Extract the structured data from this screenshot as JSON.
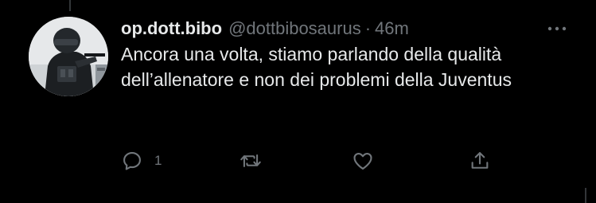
{
  "tweet": {
    "display_name": "op.dott.bibo",
    "handle": "@dottbibosaurus",
    "separator": "·",
    "timestamp": "46m",
    "text": "Ancora una volta, stiamo parlando della qualità dell’allenatore e non dei problemi della Juventus",
    "avatar_icon": "avatar-photo-soldier",
    "more_icon": "more-horizontal-icon"
  },
  "actions": {
    "reply": {
      "icon": "reply-icon",
      "count": "1"
    },
    "retweet": {
      "icon": "retweet-icon"
    },
    "like": {
      "icon": "like-icon"
    },
    "share": {
      "icon": "share-icon"
    }
  },
  "colors": {
    "background": "#000000",
    "text_primary": "#e7e9ea",
    "text_secondary": "#71767b",
    "divider": "#333639"
  }
}
